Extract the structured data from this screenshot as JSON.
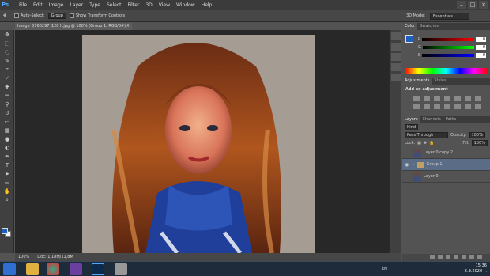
{
  "app": {
    "logo": "Ps"
  },
  "menu": [
    "File",
    "Edit",
    "Image",
    "Layer",
    "Type",
    "Select",
    "Filter",
    "3D",
    "View",
    "Window",
    "Help"
  ],
  "options": {
    "auto_select_label": "Auto-Select:",
    "auto_select_value": "Group",
    "transform_label": "Show Transform Controls",
    "mode_3d_label": "3D Mode:",
    "workspace": "Essentials"
  },
  "document": {
    "tab_title": "Image_5760297_128 ll.jpg @ 100% (Group 1, RGB/8#) *",
    "zoom": "100%",
    "doc_info": "Doc: 1,18M/11,8M"
  },
  "panels": {
    "color_tabs": [
      "Color",
      "Swatches"
    ],
    "rgb": {
      "r": "0",
      "g": "0",
      "b": "0"
    },
    "adjust_tabs": [
      "Adjustments",
      "Styles"
    ],
    "adjust_title": "Add an adjustment",
    "layers_tabs": [
      "Layers",
      "Channels",
      "Paths"
    ],
    "kind_label": "Kind",
    "blend_mode": "Pass Through",
    "opacity_label": "Opacity:",
    "opacity_value": "100%",
    "lock_label": "Lock:",
    "fill_label": "Fill:",
    "fill_value": "100%",
    "layers": [
      {
        "name": "Layer 0 copy 2",
        "selected": false,
        "visible": false
      },
      {
        "name": "Group 1",
        "selected": true,
        "visible": true
      },
      {
        "name": "Layer 0",
        "selected": false,
        "visible": false
      }
    ]
  },
  "taskbar": {
    "lang": "EN",
    "time": "15:36",
    "date": "2.9.2020 г."
  },
  "colors": {
    "foreground": "#1f5fbf",
    "background": "#ffffff",
    "accent": "#4fa8ff"
  }
}
